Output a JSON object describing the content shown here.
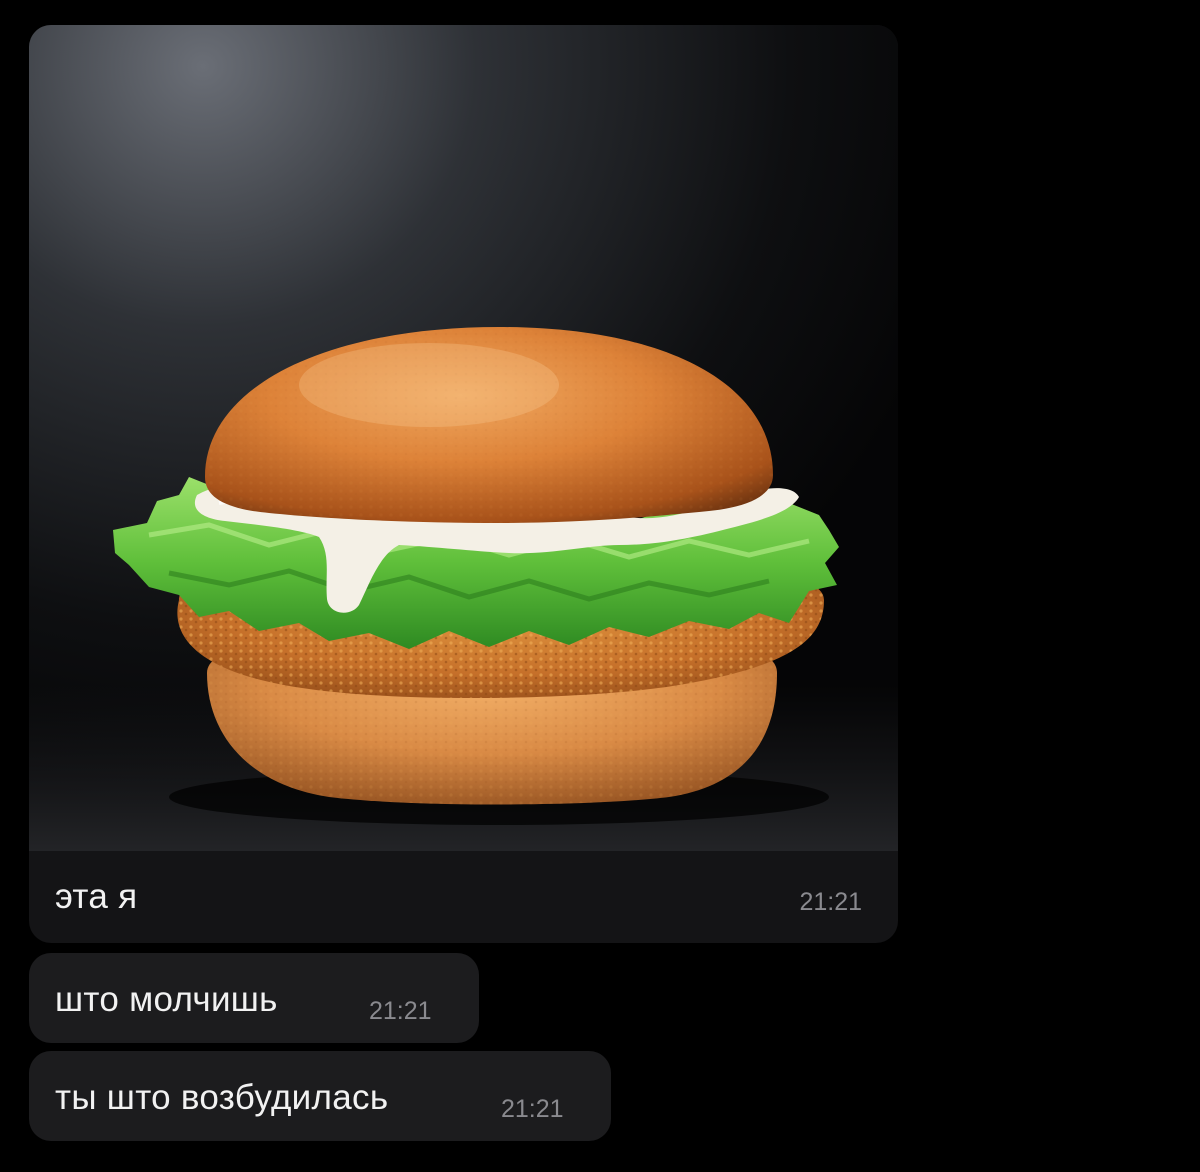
{
  "messages": [
    {
      "kind": "photo",
      "image": "burger-photo",
      "text": "эта я",
      "time": "21:21"
    },
    {
      "kind": "text",
      "text": "што молчишь",
      "time": "21:21"
    },
    {
      "kind": "text",
      "text": "ты што возбудилась",
      "time": "21:21"
    }
  ],
  "colors": {
    "background": "#000000",
    "bubble": "#1c1c1e",
    "text": "#f2f2f2",
    "time": "#8a8a8f"
  }
}
